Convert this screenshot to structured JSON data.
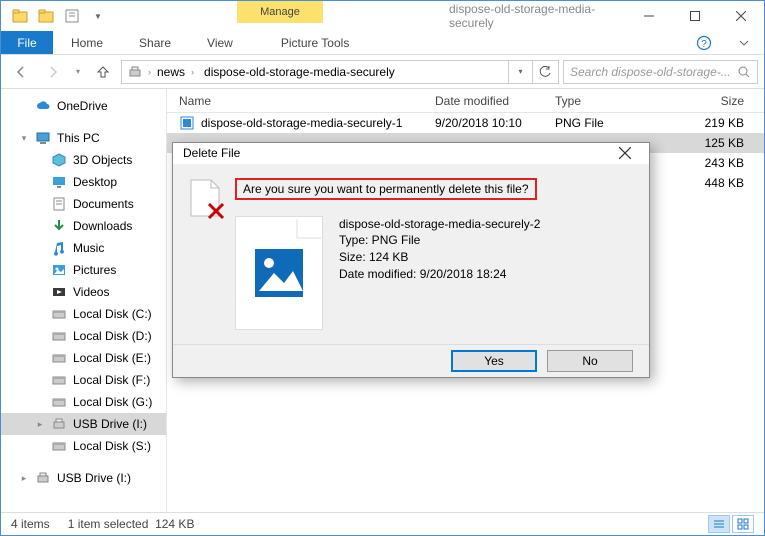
{
  "window": {
    "context_tab_group": "Manage",
    "title": "dispose-old-storage-media-securely"
  },
  "ribbon": {
    "file": "File",
    "tabs": [
      "Home",
      "Share",
      "View"
    ],
    "context_tab": "Picture Tools"
  },
  "address": {
    "segments": [
      "news",
      "dispose-old-storage-media-securely"
    ],
    "search_placeholder": "Search dispose-old-storage-..."
  },
  "nav": {
    "items": [
      {
        "label": "OneDrive",
        "icon": "cloud",
        "depth": 0,
        "exp": "",
        "spacer": false
      },
      {
        "spacer": true
      },
      {
        "label": "This PC",
        "icon": "pc",
        "depth": 0,
        "exp": "▾",
        "spacer": false
      },
      {
        "label": "3D Objects",
        "icon": "cube",
        "depth": 1,
        "exp": "",
        "spacer": false
      },
      {
        "label": "Desktop",
        "icon": "desktop",
        "depth": 1,
        "exp": "",
        "spacer": false
      },
      {
        "label": "Documents",
        "icon": "docs",
        "depth": 1,
        "exp": "",
        "spacer": false
      },
      {
        "label": "Downloads",
        "icon": "down",
        "depth": 1,
        "exp": "",
        "spacer": false
      },
      {
        "label": "Music",
        "icon": "music",
        "depth": 1,
        "exp": "",
        "spacer": false
      },
      {
        "label": "Pictures",
        "icon": "pic",
        "depth": 1,
        "exp": "",
        "spacer": false
      },
      {
        "label": "Videos",
        "icon": "video",
        "depth": 1,
        "exp": "",
        "spacer": false
      },
      {
        "label": "Local Disk (C:)",
        "icon": "disk",
        "depth": 1,
        "exp": "",
        "spacer": false
      },
      {
        "label": "Local Disk (D:)",
        "icon": "disk",
        "depth": 1,
        "exp": "",
        "spacer": false
      },
      {
        "label": "Local Disk (E:)",
        "icon": "disk",
        "depth": 1,
        "exp": "",
        "spacer": false
      },
      {
        "label": "Local Disk (F:)",
        "icon": "disk",
        "depth": 1,
        "exp": "",
        "spacer": false
      },
      {
        "label": "Local Disk (G:)",
        "icon": "disk",
        "depth": 1,
        "exp": "",
        "spacer": false
      },
      {
        "label": "USB Drive (I:)",
        "icon": "usb",
        "depth": 1,
        "exp": "▸",
        "selected": true,
        "spacer": false
      },
      {
        "label": "Local Disk (S:)",
        "icon": "disk",
        "depth": 1,
        "exp": "",
        "spacer": false
      },
      {
        "spacer": true
      },
      {
        "label": "USB Drive (I:)",
        "icon": "usb",
        "depth": 0,
        "exp": "▸",
        "spacer": false
      }
    ]
  },
  "columns": {
    "name": "Name",
    "date": "Date modified",
    "type": "Type",
    "size": "Size"
  },
  "files": [
    {
      "name": "dispose-old-storage-media-securely-1",
      "date": "9/20/2018 10:10",
      "type": "PNG File",
      "size": "219 KB",
      "selected": false
    },
    {
      "name": "",
      "date": "",
      "type": "",
      "size": "125 KB",
      "selected": true
    },
    {
      "name": "",
      "date": "",
      "type": "",
      "size": "243 KB",
      "selected": false
    },
    {
      "name": "",
      "date": "",
      "type": "",
      "size": "448 KB",
      "selected": false
    }
  ],
  "status": {
    "count": "4 items",
    "sel": "1 item selected",
    "size": "124 KB"
  },
  "dialog": {
    "title": "Delete File",
    "message": "Are you sure you want to permanently delete this file?",
    "file_name": "dispose-old-storage-media-securely-2",
    "file_type": "Type: PNG File",
    "file_size": "Size: 124 KB",
    "file_date": "Date modified: 9/20/2018 18:24",
    "yes": "Yes",
    "no": "No"
  }
}
